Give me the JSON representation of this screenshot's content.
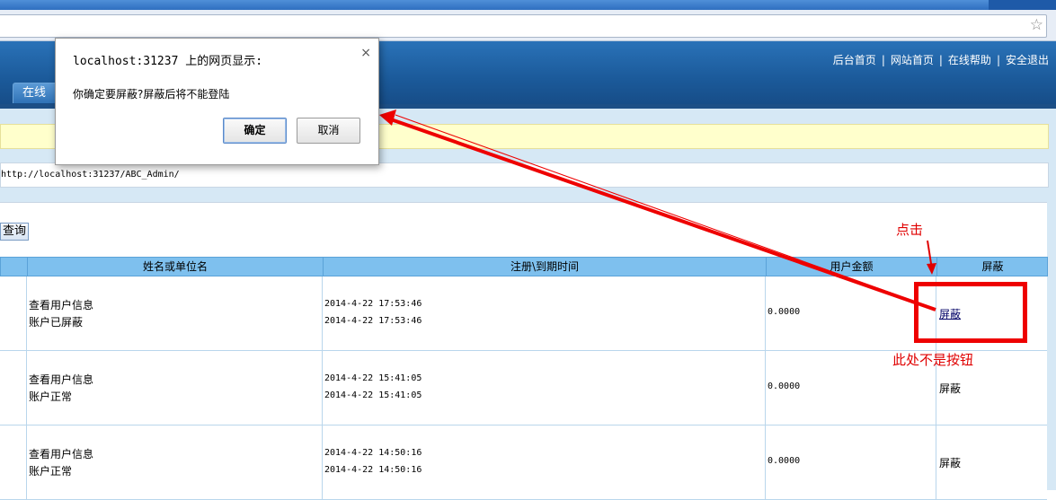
{
  "header": {
    "links": [
      "后台首页",
      "网站首页",
      "在线帮助",
      "安全退出"
    ],
    "nav_tab_partial": "在线"
  },
  "address": {
    "url": "http://localhost:31237/ABC_Admin/"
  },
  "toolbar": {
    "query_label": "查询"
  },
  "table": {
    "columns": [
      "姓名或单位名",
      "注册\\到期时间",
      "用户金额",
      "屏蔽"
    ],
    "rows": [
      {
        "info_link": "查看用户信息",
        "status": "账户已屏蔽",
        "reg_time": "2014-4-22 17:53:46",
        "exp_time": "2014-4-22 17:53:46",
        "amount": "0.0000",
        "action": "屏蔽"
      },
      {
        "info_link": "查看用户信息",
        "status": "账户正常",
        "reg_time": "2014-4-22 15:41:05",
        "exp_time": "2014-4-22 15:41:05",
        "amount": "0.0000",
        "action": "屏蔽"
      },
      {
        "info_link": "查看用户信息",
        "status": "账户正常",
        "reg_time": "2014-4-22 14:50:16",
        "exp_time": "2014-4-22 14:50:16",
        "amount": "0.0000",
        "action": "屏蔽"
      }
    ]
  },
  "dialog": {
    "title": "localhost:31237 上的网页显示:",
    "message": "你确定要屏蔽?屏蔽后将不能登陆",
    "ok_label": "确定",
    "cancel_label": "取消",
    "close_glyph": "×"
  },
  "annotations": {
    "click_note": "点击",
    "not_button_note": "此处不是按钮",
    "color": "#e00000"
  },
  "icons": {
    "star": "☆"
  }
}
